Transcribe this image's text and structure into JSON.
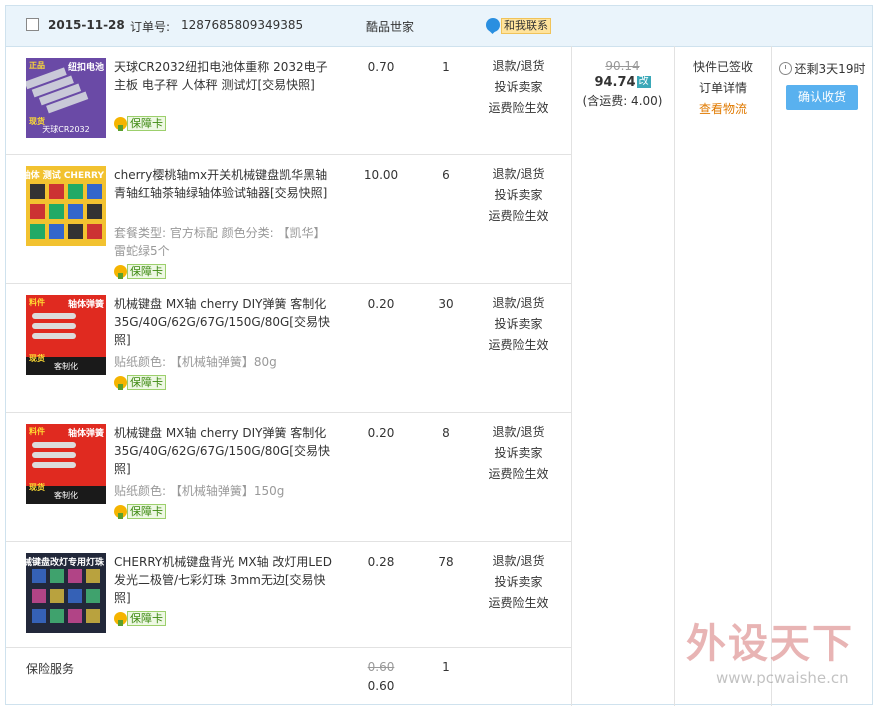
{
  "header": {
    "date": "2015-11-28",
    "order_label": "订单号:",
    "order_number": "1287685809349385",
    "shop_name": "酷品世家",
    "contact_label": "和我联系"
  },
  "items": [
    {
      "title": "天球CR2032纽扣电池体重称 2032电子主板 电子秤 人体秤 测试灯[交易快照]",
      "attr": "",
      "badge": "保障卡",
      "price": "0.70",
      "qty": "1",
      "ops": [
        "退款/退货",
        "投诉卖家",
        "运费险生效"
      ],
      "thumb": {
        "bg": "#6a4aa6",
        "text": "纽扣电池",
        "sub": "天球CR2032",
        "tag": "正品",
        "tag2": "现货"
      }
    },
    {
      "title": "cherry樱桃轴mx开关机械键盘凯华黑轴青轴红轴茶轴绿轴体验试轴器[交易快照]",
      "attr": "套餐类型: 官方标配  颜色分类: 【凯华】雷蛇绿5个",
      "badge": "保障卡",
      "price": "10.00",
      "qty": "6",
      "ops": [
        "退款/退货",
        "投诉卖家",
        "运费险生效"
      ],
      "thumb": {
        "bg": "#f2c230",
        "text": "机械轴体 测试 CHERRY",
        "sub": "",
        "tag": "",
        "tag2": ""
      }
    },
    {
      "title": "机械键盘 MX轴 cherry DIY弹簧 客制化35G/40G/62G/67G/150G/80G[交易快照]",
      "attr": "贴纸颜色: 【机械轴弹簧】80g",
      "badge": "保障卡",
      "price": "0.20",
      "qty": "30",
      "ops": [
        "退款/退货",
        "投诉卖家",
        "运费险生效"
      ],
      "thumb": {
        "bg": "#e02a20",
        "text": "轴体弹簧",
        "sub": "客制化",
        "tag": "料件",
        "tag2": "现货"
      }
    },
    {
      "title": "机械键盘 MX轴 cherry DIY弹簧 客制化35G/40G/62G/67G/150G/80G[交易快照]",
      "attr": "贴纸颜色: 【机械轴弹簧】150g",
      "badge": "保障卡",
      "price": "0.20",
      "qty": "8",
      "ops": [
        "退款/退货",
        "投诉卖家",
        "运费险生效"
      ],
      "thumb": {
        "bg": "#e02a20",
        "text": "轴体弹簧",
        "sub": "客制化",
        "tag": "料件",
        "tag2": "现货"
      }
    },
    {
      "title": "CHERRY机械键盘背光 MX轴 改灯用LED发光二极管/七彩灯珠 3mm无边[交易快照]",
      "attr": "",
      "badge": "保障卡",
      "price": "0.28",
      "qty": "78",
      "ops": [
        "退款/退货",
        "投诉卖家",
        "运费险生效"
      ],
      "thumb": {
        "bg": "#22283a",
        "text": "机械键盘改灯专用灯珠",
        "sub": "",
        "tag": "",
        "tag2": ""
      }
    }
  ],
  "total": {
    "original": "90.14",
    "current": "94.74",
    "adjust_tag": "改",
    "shipping": "(含运费: 4.00)"
  },
  "status": {
    "state": "快件已签收",
    "detail_link": "订单详情",
    "logistics_link": "查看物流"
  },
  "action": {
    "remaining": "还剩3天19时",
    "confirm_button": "确认收货"
  },
  "insurance": {
    "label": "保险服务",
    "original_price": "0.60",
    "price": "0.60",
    "qty": "1"
  },
  "watermark": {
    "brand": "外设天下",
    "url": "www.pcwaishe.cn"
  },
  "colors": {
    "header_bg": "#eaf4fb",
    "border": "#cfe2ee",
    "button": "#59b1ef",
    "logistics_link": "#e07a00",
    "badge_green": "#3e8a12"
  }
}
